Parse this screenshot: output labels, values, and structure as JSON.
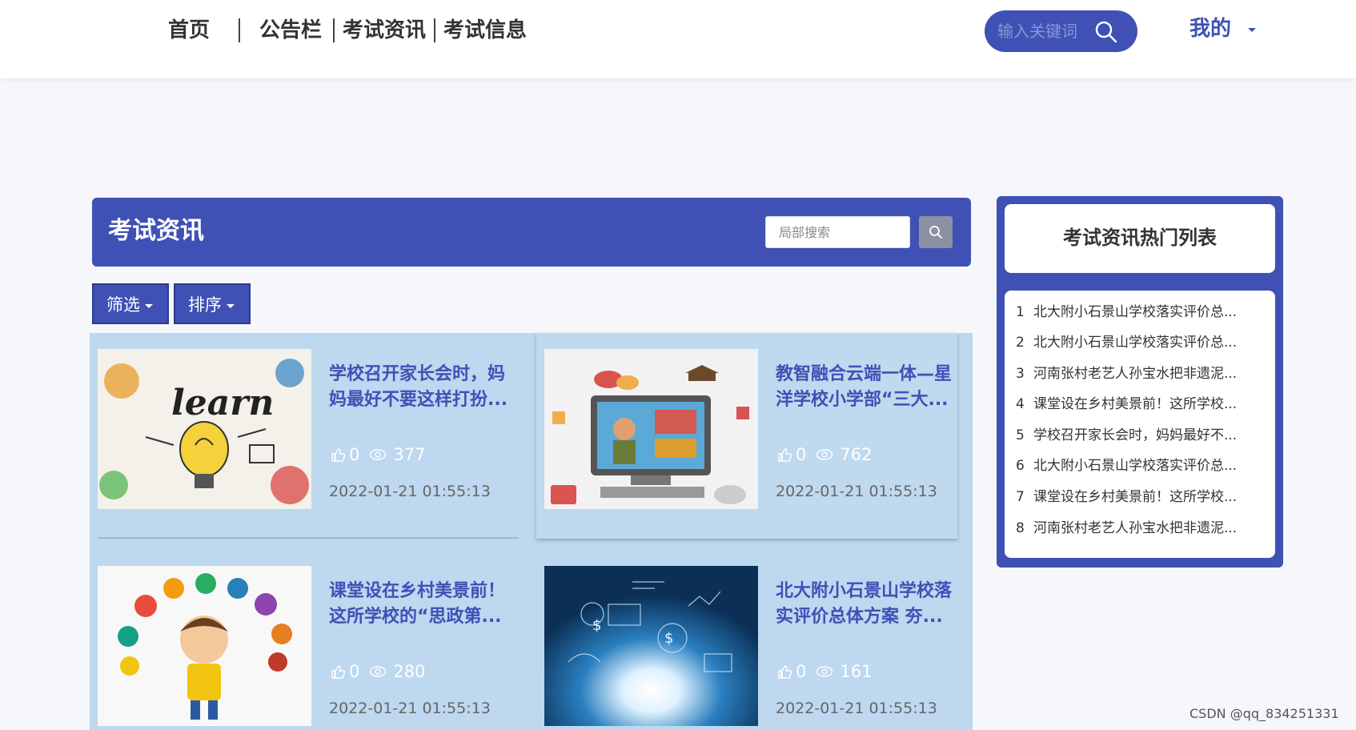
{
  "nav": {
    "items": [
      "首页",
      "公告栏",
      "考试资讯",
      "考试信息"
    ],
    "search_placeholder": "输入关键词",
    "mine_label": "我的"
  },
  "section": {
    "title": "考试资讯",
    "local_search_placeholder": "局部搜索"
  },
  "controls": {
    "filter_label": "筛选",
    "sort_label": "排序"
  },
  "cards": [
    {
      "title": "学校召开家长会时，妈妈最好不要这样打扮...",
      "likes": "0",
      "views": "377",
      "date": "2022-01-21 01:55:13"
    },
    {
      "title": "教智融合云端一体—星洋学校小学部“三大...",
      "likes": "0",
      "views": "762",
      "date": "2022-01-21 01:55:13"
    },
    {
      "title": "课堂设在乡村美景前！这所学校的“思政第...",
      "likes": "0",
      "views": "280",
      "date": "2022-01-21 01:55:13"
    },
    {
      "title": "北大附小石景山学校落实评价总体方案 夯...",
      "likes": "0",
      "views": "161",
      "date": "2022-01-21 01:55:13"
    }
  ],
  "hot": {
    "title": "考试资讯热门列表",
    "items": [
      {
        "idx": "1",
        "text": "北大附小石景山学校落实评价总..."
      },
      {
        "idx": "2",
        "text": "北大附小石景山学校落实评价总..."
      },
      {
        "idx": "3",
        "text": "河南张村老艺人孙宝水把非遗泥..."
      },
      {
        "idx": "4",
        "text": "课堂设在乡村美景前！这所学校..."
      },
      {
        "idx": "5",
        "text": "学校召开家长会时，妈妈最好不..."
      },
      {
        "idx": "6",
        "text": "北大附小石景山学校落实评价总..."
      },
      {
        "idx": "7",
        "text": "课堂设在乡村美景前！这所学校..."
      },
      {
        "idx": "8",
        "text": "河南张村老艺人孙宝水把非遗泥..."
      }
    ]
  },
  "watermark": "CSDN @qq_834251331",
  "colors": {
    "primary": "#3f51b5",
    "list_bg": "#bdd8ef",
    "page_bg": "#f5f7fa"
  }
}
